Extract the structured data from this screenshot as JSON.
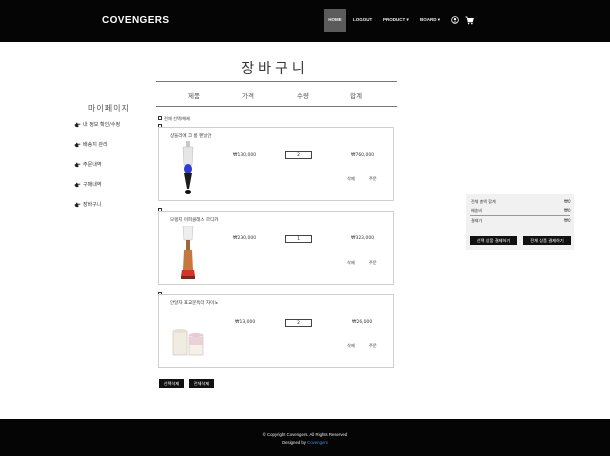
{
  "header": {
    "brand": "COVENGERS",
    "nav": {
      "home": "HOME",
      "logout": "LOGOUT",
      "product": "PRODUCT ▾",
      "board": "BOARD ▾"
    },
    "icons": [
      "user-icon",
      "cart-icon"
    ]
  },
  "page": {
    "title": "장바구니"
  },
  "columns": {
    "product": "제품",
    "price": "가격",
    "quantity": "수량",
    "total": "합계"
  },
  "sidebar": {
    "title": "마이페이지",
    "items": [
      {
        "label": "내 정보 확인/수정",
        "icon": "hand-icon"
      },
      {
        "label": "배송지 관리",
        "icon": "hand-icon"
      },
      {
        "label": "주문내역",
        "icon": "hand-icon"
      },
      {
        "label": "구매내역",
        "icon": "hand-icon"
      },
      {
        "label": "장바구니",
        "icon": "hand-icon"
      }
    ]
  },
  "select_all": {
    "label": "전체 선택/해제"
  },
  "cart_items": [
    {
      "name": "샹들리에 크 롬 펜닐안",
      "price": "₩130,000",
      "quantity": "2",
      "total": "₩760,000",
      "delete": "삭제",
      "order": "주문"
    },
    {
      "name": "모랭지 미피클래스 르디카",
      "price": "₩230,000",
      "quantity": "1",
      "total": "₩323,000",
      "delete": "삭제",
      "order": "주문"
    },
    {
      "name": "안달자 표교문독더 자이노",
      "price": "₩13,000",
      "quantity": "2",
      "total": "₩26,000",
      "delete": "삭제",
      "order": "주문"
    }
  ],
  "bulk_actions": {
    "delete_selected": "선택삭제",
    "delete_all": "전체삭제"
  },
  "summary": {
    "rows": [
      {
        "label": "전체 총액 합계",
        "value": "₩0"
      },
      {
        "label": "배송비",
        "value": "₩0"
      },
      {
        "label": "결제가",
        "value": "₩0"
      }
    ],
    "pay_selected": "선택 상품 결제하기",
    "pay_all": "전체 상품 결제하기"
  },
  "footer": {
    "copyright": "© Copyright Covengers. All Rights Reserved",
    "designed_prefix": "Designed by ",
    "designed_link": "Covengers"
  },
  "colors": {
    "header_bg": "#050505",
    "home_active": "#5b5b5b",
    "link": "#3b8ee8"
  }
}
